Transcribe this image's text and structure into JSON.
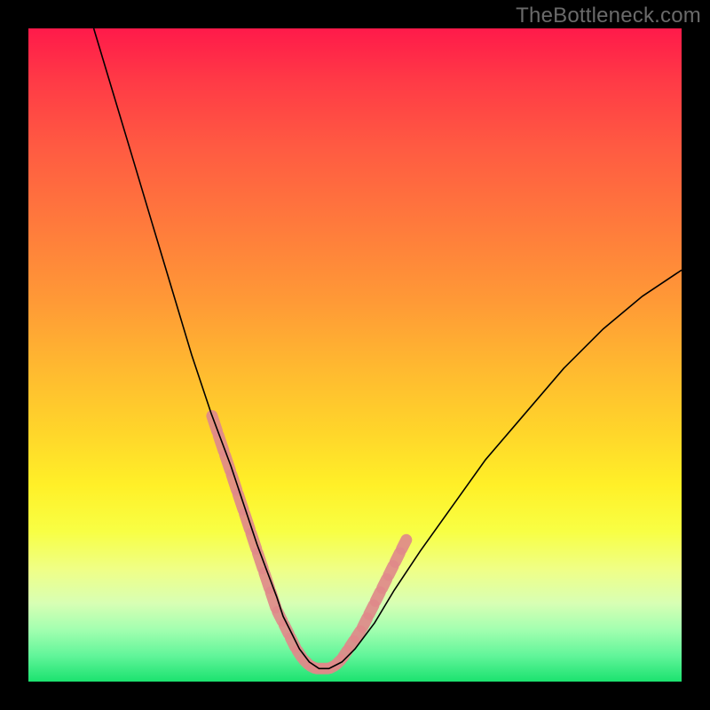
{
  "watermark": "TheBottleneck.com",
  "chart_data": {
    "type": "line",
    "title": "",
    "xlabel": "",
    "ylabel": "",
    "xlim": [
      0,
      100
    ],
    "ylim": [
      0,
      100
    ],
    "grid": false,
    "series": [
      {
        "name": "curve",
        "color": "#000000",
        "x": [
          10,
          13,
          16,
          19,
          22,
          25,
          28,
          31,
          33,
          35,
          36.5,
          38,
          39,
          40,
          41.5,
          43,
          44.5,
          46,
          48,
          50,
          53,
          56,
          60,
          65,
          70,
          76,
          82,
          88,
          94,
          100
        ],
        "y": [
          100,
          90,
          80,
          70,
          60,
          50,
          41,
          33,
          27,
          21,
          17,
          13,
          10,
          8,
          5,
          3,
          2,
          2,
          3,
          5,
          9,
          14,
          20,
          27,
          34,
          41,
          48,
          54,
          59,
          63
        ]
      }
    ],
    "highlight_segments": {
      "name": "pink-dashes",
      "color": "#e08a8a",
      "points": [
        {
          "x": 28.0,
          "y": 41
        },
        {
          "x": 29.0,
          "y": 38
        },
        {
          "x": 30.0,
          "y": 35
        },
        {
          "x": 31.0,
          "y": 32
        },
        {
          "x": 32.0,
          "y": 29
        },
        {
          "x": 33.0,
          "y": 26
        },
        {
          "x": 34.0,
          "y": 23
        },
        {
          "x": 35.0,
          "y": 20
        },
        {
          "x": 36.0,
          "y": 17
        },
        {
          "x": 37.0,
          "y": 14
        },
        {
          "x": 38.0,
          "y": 11
        },
        {
          "x": 39.0,
          "y": 9
        },
        {
          "x": 40.0,
          "y": 7
        },
        {
          "x": 41.0,
          "y": 5
        },
        {
          "x": 42.0,
          "y": 3.5
        },
        {
          "x": 43.0,
          "y": 2.5
        },
        {
          "x": 44.0,
          "y": 2
        },
        {
          "x": 45.0,
          "y": 2
        },
        {
          "x": 46.0,
          "y": 2
        },
        {
          "x": 47.0,
          "y": 2.5
        },
        {
          "x": 48.0,
          "y": 3.5
        },
        {
          "x": 49.0,
          "y": 5
        },
        {
          "x": 50.0,
          "y": 6.5
        },
        {
          "x": 51.0,
          "y": 8
        },
        {
          "x": 52.0,
          "y": 10
        },
        {
          "x": 53.0,
          "y": 12
        },
        {
          "x": 54.0,
          "y": 14
        },
        {
          "x": 55.0,
          "y": 16
        },
        {
          "x": 56.0,
          "y": 18
        },
        {
          "x": 57.0,
          "y": 20
        },
        {
          "x": 58.0,
          "y": 22
        }
      ]
    }
  }
}
